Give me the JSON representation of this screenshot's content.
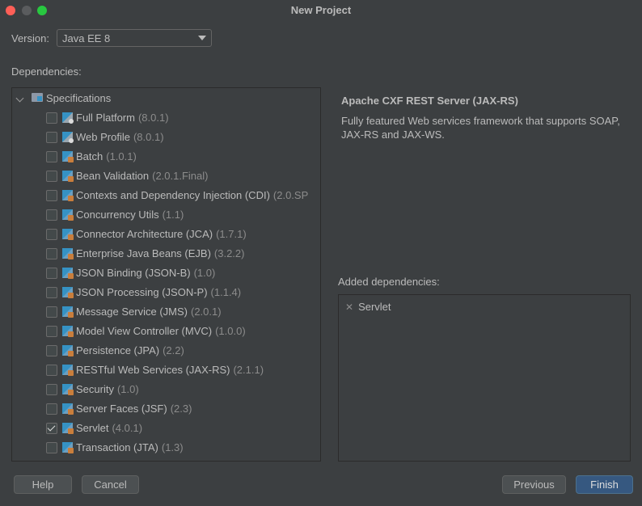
{
  "window": {
    "title": "New Project"
  },
  "version": {
    "label": "Version:",
    "value": "Java EE 8"
  },
  "dependencies": {
    "label": "Dependencies:",
    "root": "Specifications",
    "items": [
      {
        "name": "Full Platform",
        "version": "(8.0.1)",
        "checked": false
      },
      {
        "name": "Web Profile",
        "version": "(8.0.1)",
        "checked": false
      },
      {
        "name": "Batch",
        "version": "(1.0.1)",
        "checked": false
      },
      {
        "name": "Bean Validation",
        "version": "(2.0.1.Final)",
        "checked": false
      },
      {
        "name": "Contexts and Dependency Injection (CDI)",
        "version": "(2.0.SP",
        "checked": false
      },
      {
        "name": "Concurrency Utils",
        "version": "(1.1)",
        "checked": false
      },
      {
        "name": "Connector Architecture (JCA)",
        "version": "(1.7.1)",
        "checked": false
      },
      {
        "name": "Enterprise Java Beans (EJB)",
        "version": "(3.2.2)",
        "checked": false
      },
      {
        "name": "JSON Binding (JSON-B)",
        "version": "(1.0)",
        "checked": false
      },
      {
        "name": "JSON Processing (JSON-P)",
        "version": "(1.1.4)",
        "checked": false
      },
      {
        "name": "Message Service (JMS)",
        "version": "(2.0.1)",
        "checked": false
      },
      {
        "name": "Model View Controller (MVC)",
        "version": "(1.0.0)",
        "checked": false
      },
      {
        "name": "Persistence (JPA)",
        "version": "(2.2)",
        "checked": false
      },
      {
        "name": "RESTful Web Services (JAX-RS)",
        "version": "(2.1.1)",
        "checked": false
      },
      {
        "name": "Security",
        "version": "(1.0)",
        "checked": false
      },
      {
        "name": "Server Faces (JSF)",
        "version": "(2.3)",
        "checked": false
      },
      {
        "name": "Servlet",
        "version": "(4.0.1)",
        "checked": true
      },
      {
        "name": "Transaction (JTA)",
        "version": "(1.3)",
        "checked": false
      }
    ]
  },
  "description": {
    "title": "Apache CXF REST Server (JAX-RS)",
    "text": "Fully featured Web services framework that supports SOAP, JAX-RS and JAX-WS."
  },
  "added": {
    "label": "Added dependencies:",
    "items": [
      "Servlet"
    ]
  },
  "buttons": {
    "help": "Help",
    "cancel": "Cancel",
    "previous": "Previous",
    "finish": "Finish"
  }
}
